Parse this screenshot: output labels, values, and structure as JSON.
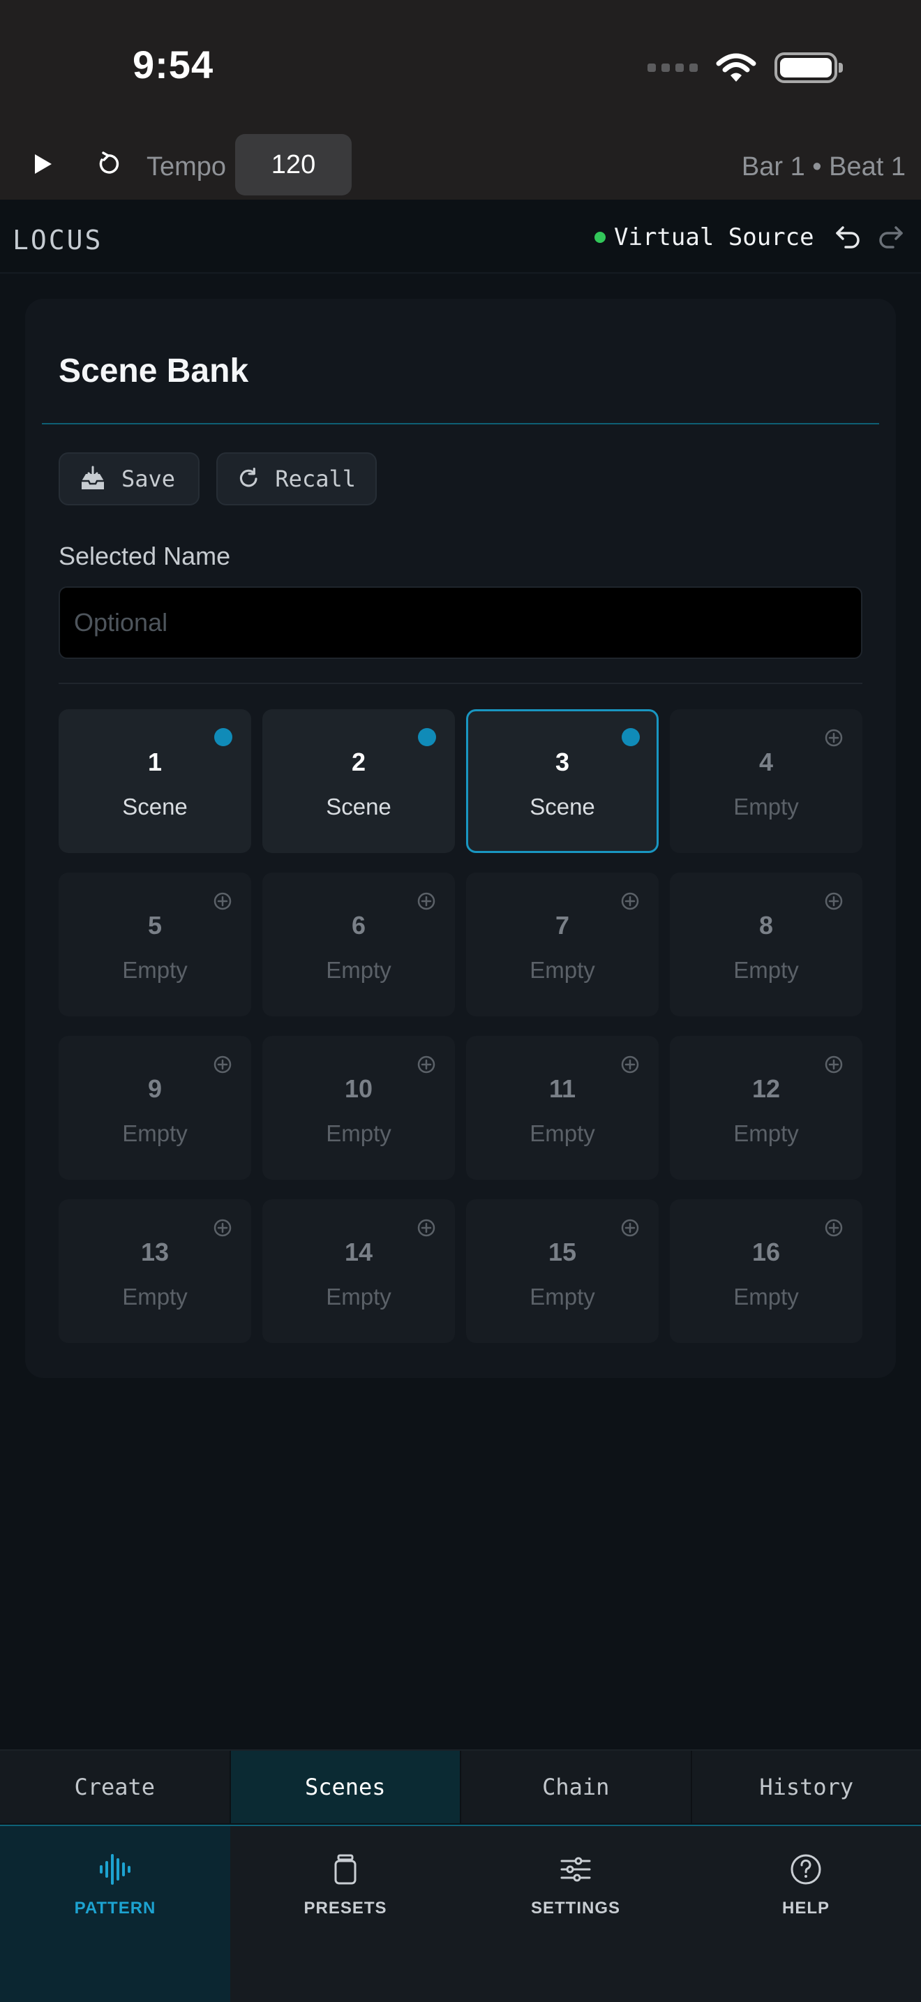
{
  "status_bar": {
    "time": "9:54"
  },
  "transport": {
    "tempo_label": "Tempo",
    "tempo_value": "120",
    "position": "Bar 1 • Beat 1"
  },
  "header": {
    "brand": "LOCUS",
    "source": "Virtual Source",
    "source_status_color": "#32c759"
  },
  "scene_bank": {
    "title": "Scene Bank",
    "save_label": "Save",
    "recall_label": "Recall",
    "name_label": "Selected Name",
    "name_placeholder": "Optional",
    "name_value": "",
    "accent_color": "#1996c1",
    "slots": [
      {
        "number": "1",
        "label": "Scene",
        "filled": true,
        "selected": false
      },
      {
        "number": "2",
        "label": "Scene",
        "filled": true,
        "selected": false
      },
      {
        "number": "3",
        "label": "Scene",
        "filled": true,
        "selected": true
      },
      {
        "number": "4",
        "label": "Empty",
        "filled": false,
        "selected": false
      },
      {
        "number": "5",
        "label": "Empty",
        "filled": false,
        "selected": false
      },
      {
        "number": "6",
        "label": "Empty",
        "filled": false,
        "selected": false
      },
      {
        "number": "7",
        "label": "Empty",
        "filled": false,
        "selected": false
      },
      {
        "number": "8",
        "label": "Empty",
        "filled": false,
        "selected": false
      },
      {
        "number": "9",
        "label": "Empty",
        "filled": false,
        "selected": false
      },
      {
        "number": "10",
        "label": "Empty",
        "filled": false,
        "selected": false
      },
      {
        "number": "11",
        "label": "Empty",
        "filled": false,
        "selected": false
      },
      {
        "number": "12",
        "label": "Empty",
        "filled": false,
        "selected": false
      },
      {
        "number": "13",
        "label": "Empty",
        "filled": false,
        "selected": false
      },
      {
        "number": "14",
        "label": "Empty",
        "filled": false,
        "selected": false
      },
      {
        "number": "15",
        "label": "Empty",
        "filled": false,
        "selected": false
      },
      {
        "number": "16",
        "label": "Empty",
        "filled": false,
        "selected": false
      }
    ]
  },
  "segments": [
    {
      "label": "Create",
      "active": false
    },
    {
      "label": "Scenes",
      "active": true
    },
    {
      "label": "Chain",
      "active": false
    },
    {
      "label": "History",
      "active": false
    }
  ],
  "bottom_nav": [
    {
      "label": "PATTERN",
      "icon": "waveform-icon",
      "active": true
    },
    {
      "label": "PRESETS",
      "icon": "jar-icon",
      "active": false
    },
    {
      "label": "SETTINGS",
      "icon": "sliders-icon",
      "active": false
    },
    {
      "label": "HELP",
      "icon": "help-icon",
      "active": false
    }
  ]
}
